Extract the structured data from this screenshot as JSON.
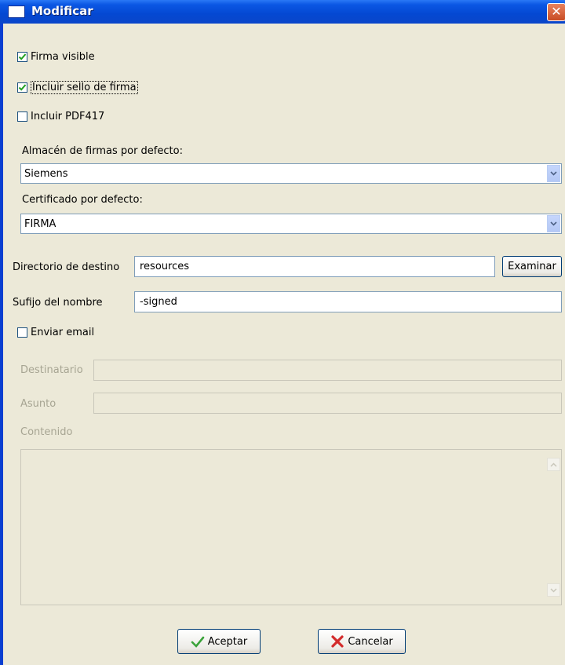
{
  "window": {
    "title": "Modificar",
    "close_glyph": "✕"
  },
  "options": {
    "firma_visible": {
      "label": "Firma visible",
      "checked": true
    },
    "sello": {
      "label": "Incluir sello de firma",
      "checked": true
    },
    "pdf417": {
      "label": "Incluir PDF417",
      "checked": false
    }
  },
  "almacen": {
    "label": "Almacén de firmas por defecto:",
    "value": "Siemens"
  },
  "certificado": {
    "label": "Certificado por defecto:",
    "value": "FIRMA"
  },
  "destino": {
    "label": "Directorio de destino",
    "value": "resources",
    "browse_label": "Examinar"
  },
  "sufijo": {
    "label": "Sufijo del nombre",
    "value": "-signed"
  },
  "email": {
    "label": "Enviar email",
    "checked": false,
    "destinatario_label": "Destinatario",
    "destinatario_value": "",
    "asunto_label": "Asunto",
    "asunto_value": "",
    "contenido_label": "Contenido"
  },
  "buttons": {
    "accept_label": "Aceptar",
    "cancel_label": "Cancelar"
  },
  "colors": {
    "titlebar": "#0448d2",
    "client_bg": "#ece9d8",
    "field_border": "#7f9db9",
    "check_green": "#21a121"
  },
  "icons": {
    "accept": "checkmark-icon",
    "cancel": "red-x-icon"
  }
}
